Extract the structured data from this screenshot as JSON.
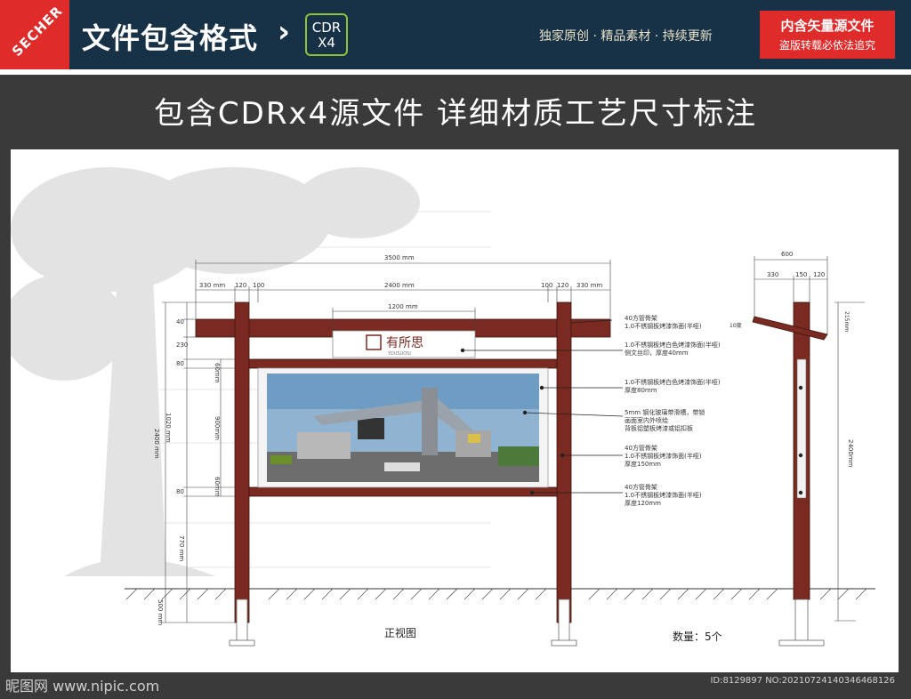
{
  "brand": {
    "ribbon_text": "SECHER"
  },
  "header": {
    "title": "文件包含格式",
    "chevron": "›",
    "format_badge": [
      "CDR",
      "X4"
    ],
    "slogan": "独家原创 · 精品素材 · 持续更新",
    "notice": [
      "内含矢量源文件",
      "盗版转载必依法追究"
    ]
  },
  "headline": "包含CDRx4源文件   详细材质工艺尺寸标注",
  "drawing": {
    "front_dims_top": {
      "overall": "3500 mm",
      "segments": [
        "330 mm",
        "120",
        "100",
        "2400 mm",
        "100",
        "120",
        "330 mm"
      ],
      "logo_width": "1200 mm"
    },
    "left_dims": [
      "40",
      "230",
      "80",
      "1020 mm",
      "80",
      "770 mm",
      "500 mm"
    ],
    "left_total": "2400 mm",
    "inner_dims": [
      "60mm",
      "900mm",
      "60mm"
    ],
    "logo_text": "有所思",
    "logo_sub": "YOUSUOSI",
    "notes": [
      "40方管骨架",
      "1.0不锈钢板烤漆饰面(半哑)",
      "1.0不锈钢板烤白色烤漆饰面(半哑)",
      "侧文丝印，厚度40mm",
      "1.0不锈钢板烤白色烤漆饰面(半哑)",
      "厚度80mm",
      "5mm 钢化玻璃带滑槽，带锁",
      "画面室内外喷绘",
      "背板铝塑板烤漆或铝扣板",
      "40方管骨架",
      "1.0不锈钢板烤漆饰面(半哑)",
      "厚度150mm",
      "40方管骨架",
      "1.0不锈钢板烤漆饰面(半哑)",
      "厚度120mm"
    ],
    "side_dims": {
      "width": "600",
      "segments": [
        "330",
        "150",
        "120"
      ],
      "angle": "10度",
      "top": "215mm",
      "total": "2400mm"
    },
    "caption": "正视图",
    "quantity": "数量：5个"
  },
  "footer": {
    "watermark": "昵图网 www.nipic.com",
    "id_text": "ID:8129897 NO:20210724140346468126"
  },
  "colors": {
    "post": "#7a2a20",
    "accent_red": "#e02b2b",
    "navy": "#173146",
    "badge_green": "#8fc23a"
  }
}
